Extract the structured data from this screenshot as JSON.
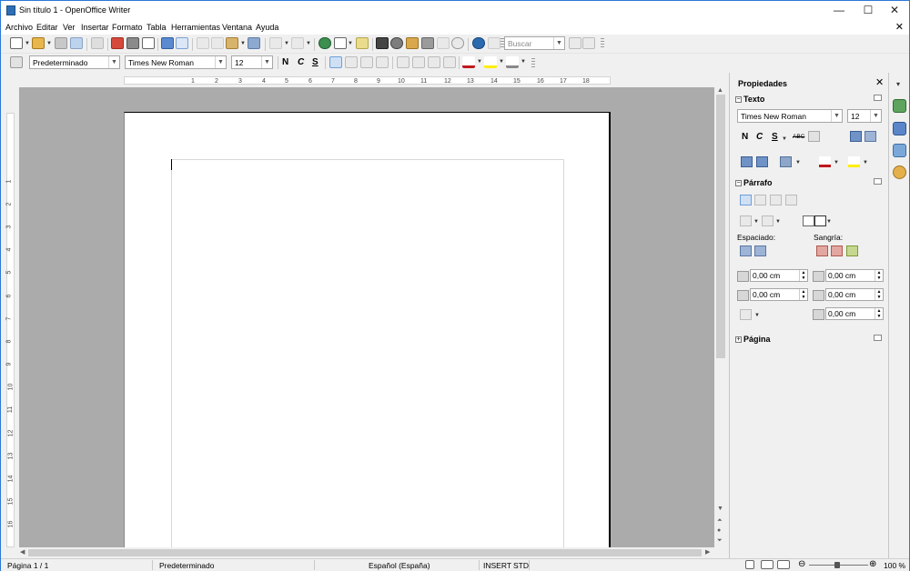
{
  "window": {
    "title": "Sin título 1 - OpenOffice Writer",
    "minimize": "—",
    "maximize": "☐",
    "close": "✕"
  },
  "menu": [
    "Archivo",
    "Editar",
    "Ver",
    "Insertar",
    "Formato",
    "Tabla",
    "Herramientas",
    "Ventana",
    "Ayuda"
  ],
  "menu_doc_close": "✕",
  "toolbar": {
    "search_placeholder": "Buscar",
    "paragraph_style": "Predeterminado",
    "font_name": "Times New Roman",
    "font_size": "12",
    "bold": "N",
    "italic": "C",
    "underline": "S"
  },
  "ruler": {
    "h_ticks": [
      "1",
      "2",
      "3",
      "4",
      "5",
      "6",
      "7",
      "8",
      "9",
      "10",
      "11",
      "12",
      "13",
      "14",
      "15",
      "16",
      "17",
      "18"
    ],
    "v_ticks": [
      "1",
      "2",
      "3",
      "4",
      "5",
      "6",
      "7",
      "8",
      "9",
      "10",
      "11",
      "12",
      "13",
      "14",
      "15",
      "16"
    ]
  },
  "sidebar": {
    "title": "Propiedades",
    "close": "✕",
    "texto": {
      "title": "Texto",
      "font_name": "Times New Roman",
      "font_size": "12",
      "bold": "N",
      "italic": "C",
      "underline": "S",
      "strike": "ABC"
    },
    "parrafo": {
      "title": "Párrafo",
      "spacing_label": "Espaciado:",
      "indent_label": "Sangría:",
      "above": "0,00 cm",
      "below": "0,00 cm",
      "before_text": "0,00 cm",
      "after_text": "0,00 cm",
      "first_line": "0,00 cm"
    },
    "pagina": {
      "title": "Página"
    }
  },
  "status": {
    "page": "Página  1 / 1",
    "style": "Predeterminado",
    "language": "Español (España)",
    "insert": "INSERT",
    "select": "STD",
    "zoom": "100 %"
  },
  "colors": {
    "accent": "#2b78d7",
    "doc_background": "#ababab",
    "page": "#ffffff"
  }
}
